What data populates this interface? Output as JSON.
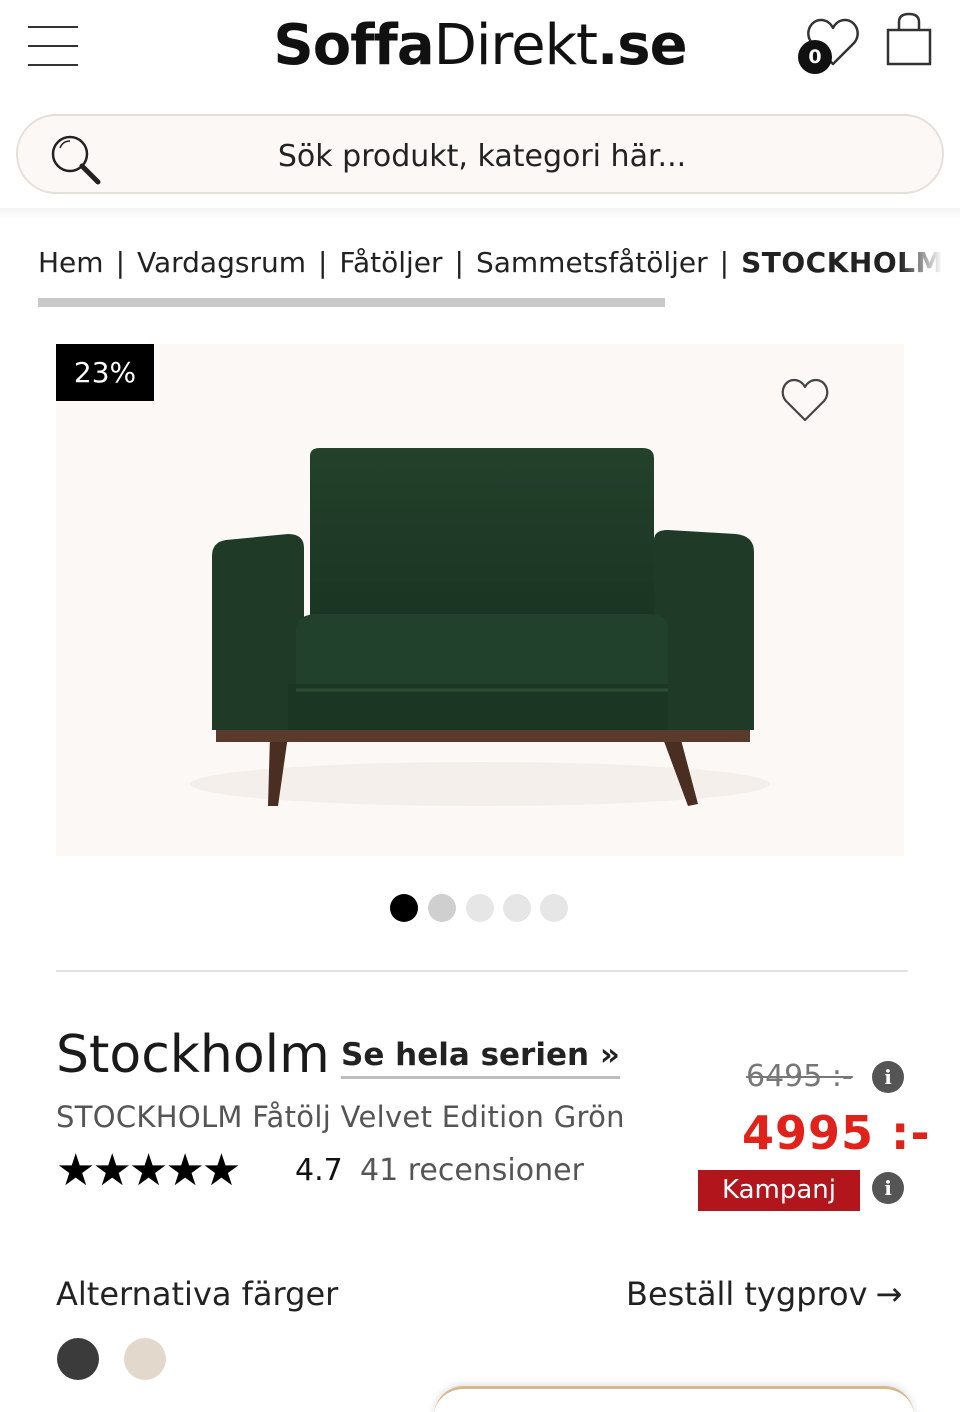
{
  "header": {
    "logo": {
      "part1": "Soffa",
      "part2": "Direkt",
      "part3": ".se"
    },
    "wishlist_count": "0",
    "search_placeholder": "Sök produkt, kategori här..."
  },
  "breadcrumb": {
    "items": [
      "Hem",
      "Vardagsrum",
      "Fåtöljer",
      "Sammetsfåtöljer"
    ],
    "current": "STOCKHOLM Fåtölj Velvet Edition Grön"
  },
  "gallery": {
    "discount_badge": "23%",
    "dot_count": 5,
    "active_dot": 0
  },
  "product": {
    "name": "Stockholm",
    "series_link": "Se hela serien »",
    "subtitle": "STOCKHOLM Fåtölj Velvet Edition Grön",
    "stars": "★★★★★",
    "rating": "4.7",
    "reviews": "41 recensioner",
    "old_price": "6495 :-",
    "new_price": "4995 :-",
    "campaign_label": "Kampanj",
    "info_glyph": "i"
  },
  "colors": {
    "title": "Alternativa färger",
    "order_sample": "Beställ tygprov",
    "order_arrow": "→",
    "swatches": [
      "#3a3b3a",
      "#e3d8cc"
    ]
  },
  "theme": {
    "price_red": "#e1221a",
    "campaign_red": "#b3151d",
    "sofa_green": "#1f3a26"
  }
}
